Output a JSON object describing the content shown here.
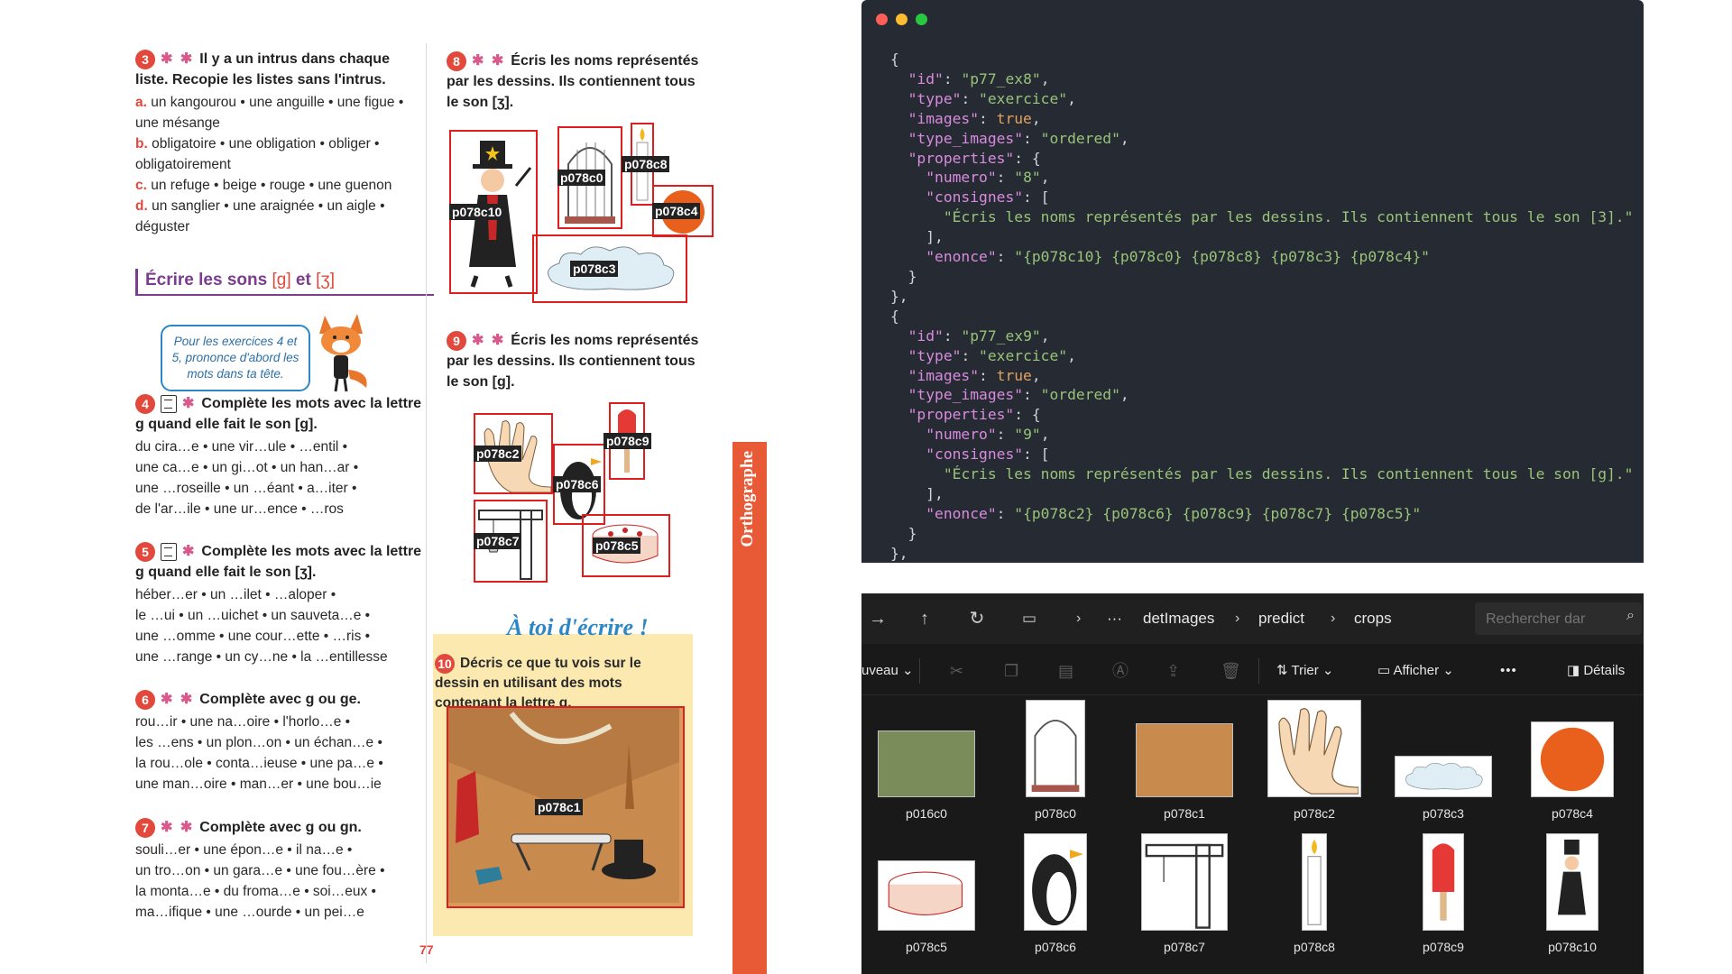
{
  "book": {
    "ex3": {
      "num": "3",
      "stars": "✱ ✱",
      "title": "Il y a un intrus dans chaque liste. Recopie les listes sans l'intrus.",
      "items": [
        {
          "letter": "a.",
          "text": "un kangourou • une anguille • une figue • une mésange"
        },
        {
          "letter": "b.",
          "text": "obligatoire • une obligation • obliger • obligatoirement"
        },
        {
          "letter": "c.",
          "text": "un refuge • beige • rouge • une guenon"
        },
        {
          "letter": "d.",
          "text": "un sanglier • une araignée • un aigle • déguster"
        }
      ]
    },
    "section": {
      "title": "Écrire les sons",
      "ph1": "[g]",
      "and": "et",
      "ph2": "[ʒ]"
    },
    "bubble": "Pour les exercices 4 et 5, prononce d'abord les mots dans ta tête.",
    "ex4": {
      "num": "4",
      "stars": "✱",
      "title": "Complète les mots avec la lettre g quand elle fait le son [g].",
      "lines": [
        "du cira…e • une vir…ule • …entil •",
        "une ca…e • un gi…ot • un han…ar •",
        "une …roseille • un …éant • a…iter •",
        "de l'ar…ile • une ur…ence • …ros"
      ]
    },
    "ex5": {
      "num": "5",
      "stars": "✱",
      "title": "Complète les mots avec la lettre g quand elle fait le son [ʒ].",
      "lines": [
        "héber…er • un …ilet • …aloper •",
        "le …ui • un …uichet • un sauveta…e •",
        "une …omme • une cour…ette • …ris •",
        "une …range • un cy…ne • la …entillesse"
      ]
    },
    "ex6": {
      "num": "6",
      "stars": "✱ ✱",
      "title": "Complète avec g ou ge.",
      "lines": [
        "rou…ir • une na…oire • l'horlo…e •",
        "les …ens • un plon…on • un échan…e •",
        "la rou…ole • conta…ieuse • une pa…e •",
        "une man…oire • man…er • une bou…ie"
      ]
    },
    "ex7": {
      "num": "7",
      "stars": "✱ ✱",
      "title": "Complète avec g ou gn.",
      "lines": [
        "souli…er • une épon…e • il na…e •",
        "un tro…on • un gara…e • une fou…ère •",
        "la monta…e • du froma…e • soi…eux •",
        "ma…ifique • une …ourde • un pei…e"
      ]
    },
    "ex8": {
      "num": "8",
      "stars": "✱ ✱",
      "title": "Écris les noms représentés par les dessins. Ils contiennent tous le son [ʒ]."
    },
    "ex9": {
      "num": "9",
      "stars": "✱ ✱",
      "title": "Écris les noms représentés par les dessins. Ils contiennent tous le son [g]."
    },
    "write_heading": "À toi d'écrire !",
    "ex10": {
      "num": "10",
      "title": "Décris ce que tu vois sur le dessin en utilisant des mots contenant la lettre g."
    },
    "side_tab": "Orthographe",
    "page_number": "77",
    "labels": {
      "p078c10": "p078c10",
      "p078c0": "p078c0",
      "p078c8": "p078c8",
      "p078c4": "p078c4",
      "p078c3": "p078c3",
      "p078c2": "p078c2",
      "p078c9": "p078c9",
      "p078c6": "p078c6",
      "p078c7": "p078c7",
      "p078c5": "p078c5",
      "p078c1": "p078c1"
    }
  },
  "code": {
    "entries": [
      {
        "id": "p77_ex8",
        "type": "exercice",
        "images": "true",
        "type_images": "ordered",
        "numero": "8",
        "consigne": "Écris les noms représentés par les dessins. Ils contiennent tous le son [3].",
        "enonce": "{p078c10} {p078c0} {p078c8} {p078c3} {p078c4}"
      },
      {
        "id": "p77_ex9",
        "type": "exercice",
        "images": "true",
        "type_images": "ordered",
        "numero": "9",
        "consigne": "Écris les noms représentés par les dessins. Ils contiennent tous le son [g].",
        "enonce": "{p078c2} {p078c6} {p078c9} {p078c7} {p078c5}"
      }
    ]
  },
  "explorer": {
    "breadcrumb": [
      "detImages",
      "predict",
      "crops"
    ],
    "search_placeholder": "Rechercher dar",
    "toolbar": {
      "new_label": "uveau",
      "sort_label": "Trier",
      "view_label": "Afficher",
      "more_label": "•••",
      "details_label": "Détails"
    },
    "files": [
      "p016c0",
      "p078c0",
      "p078c1",
      "p078c2",
      "p078c3",
      "p078c4",
      "p078c5",
      "p078c6",
      "p078c7",
      "p078c8",
      "p078c9",
      "p078c10"
    ]
  }
}
